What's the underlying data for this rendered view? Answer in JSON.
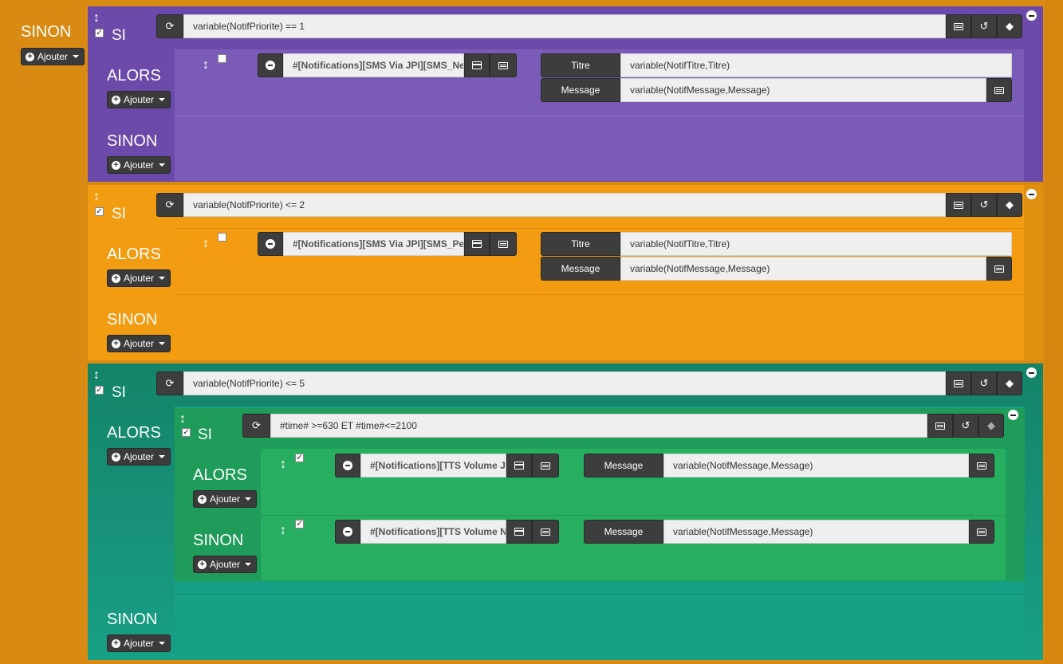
{
  "labels": {
    "si": "SI",
    "alors": "ALORS",
    "sinon": "SINON",
    "ajouter": "Ajouter"
  },
  "outer": {
    "sinon_label": "SINON",
    "ajouter_label": "Ajouter"
  },
  "block1": {
    "condition": "variable(NotifPriorite) == 1",
    "action": {
      "command": "#[Notifications][SMS Via JPI][SMS_Ne",
      "titre_label": "Titre",
      "titre_value": "variable(NotifTitre,Titre)",
      "message_label": "Message",
      "message_value": "variable(NotifMessage,Message)"
    },
    "colors": {
      "bg": "#7859b4",
      "alors_bg": "#7a5cb8",
      "frame": "#6a48a8"
    }
  },
  "block2": {
    "condition": "variable(NotifPriorite) <= 2",
    "action": {
      "command": "#[Notifications][SMS Via JPI][SMS_Pe",
      "titre_label": "Titre",
      "titre_value": "variable(NotifTitre,Titre)",
      "message_label": "Message",
      "message_value": "variable(NotifMessage,Message)"
    },
    "colors": {
      "bg": "#f29c12"
    }
  },
  "block3": {
    "condition": "variable(NotifPriorite) <= 5",
    "inner": {
      "condition": "#time# >=630 ET #time#<=2100",
      "alors_action": {
        "command": "#[Notifications][TTS Volume J",
        "message_label": "Message",
        "message_value": "variable(NotifMessage,Message)"
      },
      "sinon_action": {
        "command": "#[Notifications][TTS Volume N",
        "message_label": "Message",
        "message_value": "variable(NotifMessage,Message)"
      }
    },
    "colors": {
      "bg": "#17937a",
      "inner_bg": "#27ae60"
    }
  }
}
